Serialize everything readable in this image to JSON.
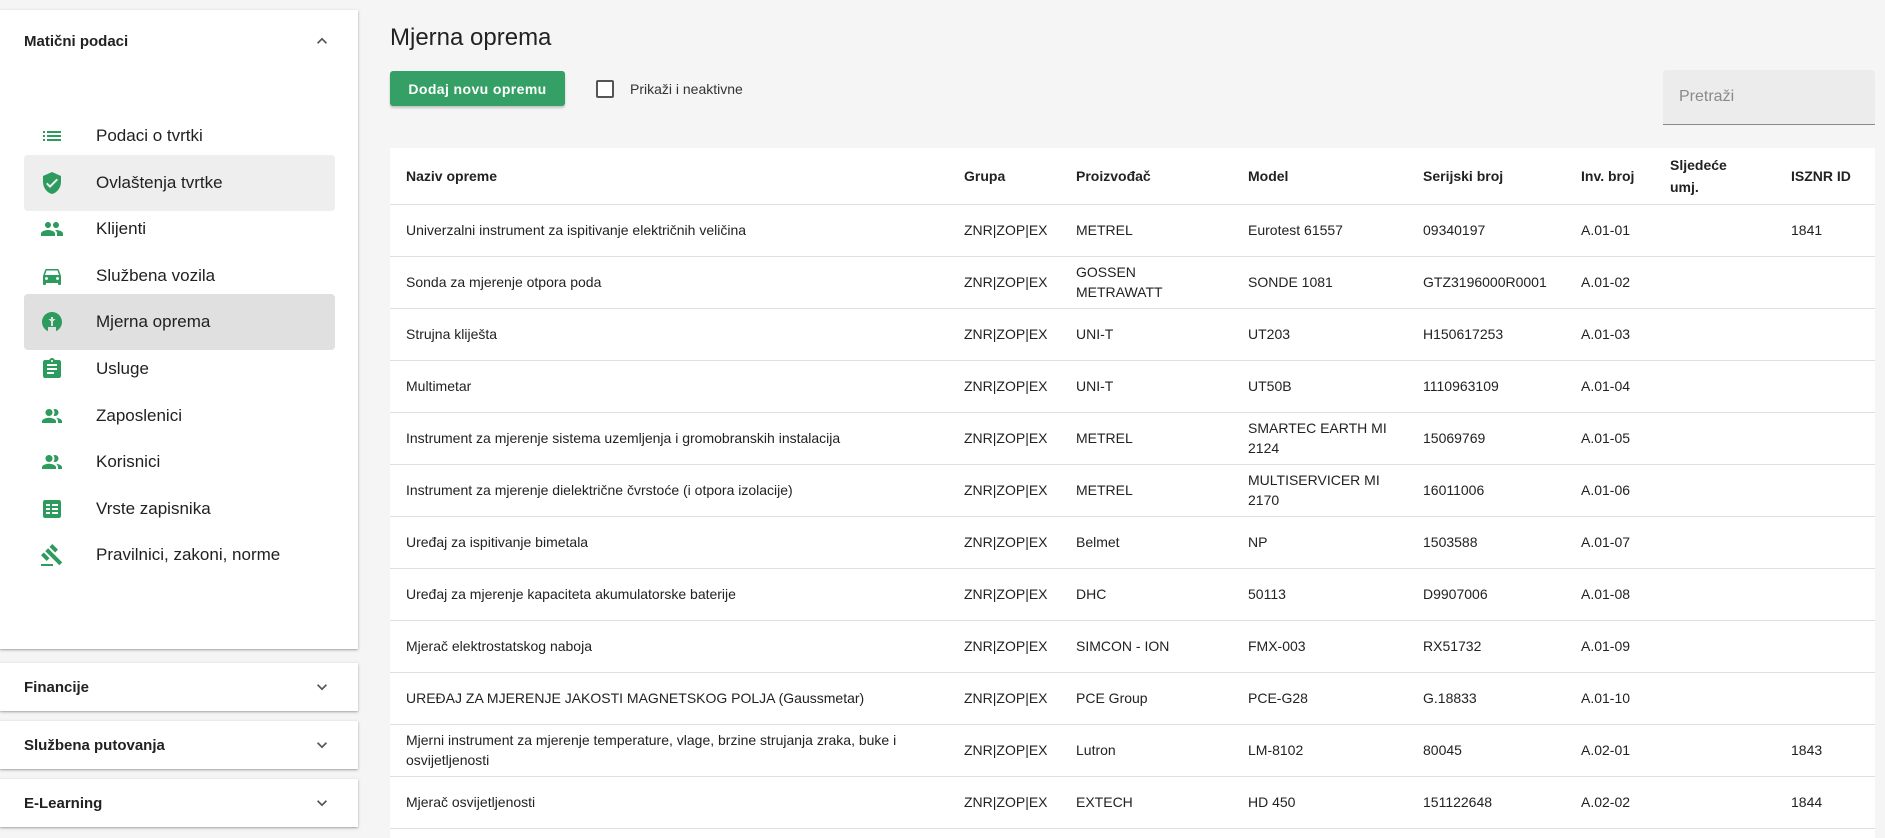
{
  "sidebar": {
    "sections": {
      "maticni": {
        "title": "Matični podaci"
      },
      "financije": {
        "title": "Financije"
      },
      "putovanja": {
        "title": "Službena putovanja"
      },
      "elearning": {
        "title": "E-Learning"
      }
    },
    "items": [
      {
        "label": "Podaci o tvrtki",
        "icon": "list-icon"
      },
      {
        "label": "Ovlaštenja tvrtke",
        "icon": "shield-check-icon"
      },
      {
        "label": "Klijenti",
        "icon": "people-icon"
      },
      {
        "label": "Službena vozila",
        "icon": "car-icon"
      },
      {
        "label": "Mjerna oprema",
        "icon": "gauge-icon"
      },
      {
        "label": "Usluge",
        "icon": "clipboard-icon"
      },
      {
        "label": "Zaposlenici",
        "icon": "group-icon"
      },
      {
        "label": "Korisnici",
        "icon": "group-icon"
      },
      {
        "label": "Vrste zapisnika",
        "icon": "checklist-icon"
      },
      {
        "label": "Pravilnici, zakoni, norme",
        "icon": "gavel-icon"
      }
    ],
    "active_item": "Mjerna oprema",
    "hover_item": "Ovlaštenja tvrtke"
  },
  "main": {
    "title": "Mjerna oprema",
    "add_button": "Dodaj novu opremu",
    "show_inactive_label": "Prikaži i neaktivne",
    "search_placeholder": "Pretraži"
  },
  "colors": {
    "accent": "#34a065",
    "icon": "#2e9b5e"
  },
  "table": {
    "headers": [
      "Naziv opreme",
      "Grupa",
      "Proizvođač",
      "Model",
      "Serijski broj",
      "Inv. broj",
      "Sljedeće umj.",
      "ISZNR ID"
    ],
    "rows": [
      [
        "Univerzalni instrument za ispitivanje električnih veličina",
        "ZNR|ZOP|EX",
        "METREL",
        "Eurotest 61557",
        "09340197",
        "A.01-01",
        "",
        "1841"
      ],
      [
        "Sonda za mjerenje otpora poda",
        "ZNR|ZOP|EX",
        "GOSSEN METRAWATT",
        "SONDE 1081",
        "GTZ3196000R0001",
        "A.01-02",
        "",
        ""
      ],
      [
        "Strujna kliješta",
        "ZNR|ZOP|EX",
        "UNI-T",
        "UT203",
        "H150617253",
        "A.01-03",
        "",
        ""
      ],
      [
        "Multimetar",
        "ZNR|ZOP|EX",
        "UNI-T",
        "UT50B",
        "1110963109",
        "A.01-04",
        "",
        ""
      ],
      [
        "Instrument za mjerenje sistema uzemljenja i gromobranskih instalacija",
        "ZNR|ZOP|EX",
        "METREL",
        "SMARTEC EARTH MI 2124",
        "15069769",
        "A.01-05",
        "",
        ""
      ],
      [
        "Instrument za mjerenje dielektrične čvrstoće (i otpora izolacije)",
        "ZNR|ZOP|EX",
        "METREL",
        "MULTISERVICER MI 2170",
        "16011006",
        "A.01-06",
        "",
        ""
      ],
      [
        "Uređaj za ispitivanje bimetala",
        "ZNR|ZOP|EX",
        "Belmet",
        "NP",
        "1503588",
        "A.01-07",
        "",
        ""
      ],
      [
        "Uređaj za mjerenje kapaciteta akumulatorske baterije",
        "ZNR|ZOP|EX",
        "DHC",
        "50113",
        "D9907006",
        "A.01-08",
        "",
        ""
      ],
      [
        "Mjerač elektrostatskog naboja",
        "ZNR|ZOP|EX",
        "SIMCON - ION",
        "FMX-003",
        "RX51732",
        "A.01-09",
        "",
        ""
      ],
      [
        "UREĐAJ ZA MJERENJE JAKOSTI MAGNETSKOG POLJA (Gaussmetar)",
        "ZNR|ZOP|EX",
        "PCE Group",
        "PCE-G28",
        "G.18833",
        "A.01-10",
        "",
        ""
      ],
      [
        "Mjerni instrument za mjerenje temperature, vlage, brzine strujanja zraka, buke i osvijetljenosti",
        "ZNR|ZOP|EX",
        "Lutron",
        "LM-8102",
        "80045",
        "A.02-01",
        "",
        "1843"
      ],
      [
        "Mjerač osvijetljenosti",
        "ZNR|ZOP|EX",
        "EXTECH",
        "HD 450",
        "151122648",
        "A.02-02",
        "",
        "1844"
      ]
    ]
  }
}
